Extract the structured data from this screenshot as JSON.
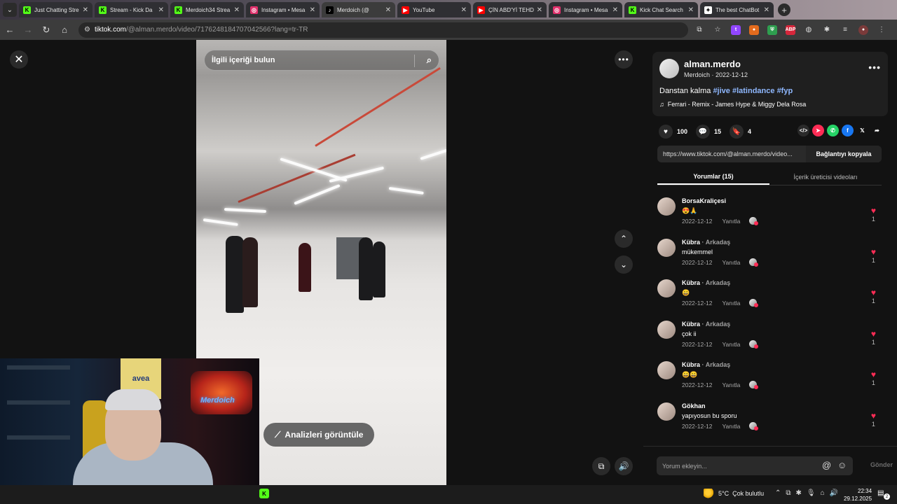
{
  "browser": {
    "tabs": [
      {
        "title": "Just Chatting Stre",
        "favicon": "K",
        "color": "#53fc18"
      },
      {
        "title": "Stream - Kick Da",
        "favicon": "K",
        "color": "#53fc18"
      },
      {
        "title": "Merdoich34 Strea",
        "favicon": "K",
        "color": "#53fc18"
      },
      {
        "title": "Instagram • Mesa",
        "favicon": "◎",
        "color": "#e1306c"
      },
      {
        "title": "Merdoich (@",
        "favicon": "♪",
        "color": "#000000",
        "active": true
      },
      {
        "title": "YouTube",
        "favicon": "▶",
        "color": "#ff0000"
      },
      {
        "title": "ÇİN ABD'Yİ TEHD",
        "favicon": "▶",
        "color": "#ff0000"
      },
      {
        "title": "Instagram • Mesa",
        "favicon": "◎",
        "color": "#e1306c"
      },
      {
        "title": "Kick Chat Search",
        "favicon": "K",
        "color": "#53fc18"
      },
      {
        "title": "The best ChatBot",
        "favicon": "✦",
        "color": "#ffffff"
      }
    ],
    "url_host": "tiktok.com",
    "url_path": "/@alman.merdo/video/7176248184707042566?lang=tr-TR"
  },
  "video": {
    "search_placeholder": "İlgili içeriği bulun",
    "analytics_label": "Analizleri görüntüle"
  },
  "post": {
    "username": "alman.merdo",
    "display_name": "Merdoich",
    "date": "2022-12-12",
    "caption_text": "Danstan kalma",
    "hashtags": [
      "#jive",
      "#latindance",
      "#fyp"
    ],
    "music": "Ferrari - Remix - James Hype & Miggy Dela Rosa",
    "likes": "100",
    "comments": "15",
    "saves": "4",
    "link": "https://www.tiktok.com/@alman.merdo/video...",
    "copy_link_label": "Bağlantıyı kopyala"
  },
  "panel_tabs": {
    "comments": "Yorumlar (15)",
    "creator_videos": "İçerik üreticisi videoları"
  },
  "comments": [
    {
      "user": "BorsaKraliçesi",
      "relation": "",
      "text": "😍🙏",
      "date": "2022-12-12",
      "reply": "Yanıtla",
      "likes": "1"
    },
    {
      "user": "Kübra",
      "relation": "· Arkadaş",
      "text": "mükemmel",
      "date": "2022-12-12",
      "reply": "Yanıtla",
      "likes": "1"
    },
    {
      "user": "Kübra",
      "relation": "· Arkadaş",
      "text": "😄",
      "date": "2022-12-12",
      "reply": "Yanıtla",
      "likes": "1"
    },
    {
      "user": "Kübra",
      "relation": "· Arkadaş",
      "text": "çok ii",
      "date": "2022-12-12",
      "reply": "Yanıtla",
      "likes": "1"
    },
    {
      "user": "Kübra",
      "relation": "· Arkadaş",
      "text": "😄😄",
      "date": "2022-12-12",
      "reply": "Yanıtla",
      "likes": "1"
    },
    {
      "user": "Gökhan",
      "relation": "",
      "text": "yapıyosun bu sporu",
      "date": "2022-12-12",
      "reply": "Yanıtla",
      "likes": "1"
    }
  ],
  "comment_box": {
    "placeholder": "Yorum ekleyin...",
    "send_label": "Gönder"
  },
  "webcam": {
    "poster_text": "avea",
    "neon_text": "Merdoich"
  },
  "taskbar": {
    "weather_temp": "5°C",
    "weather_desc": "Çok bulutlu",
    "time": "22:34",
    "date": "29.12.2025",
    "notifications": "2"
  }
}
